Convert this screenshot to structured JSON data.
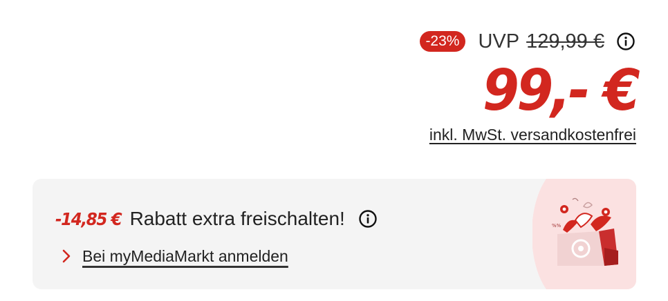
{
  "price": {
    "discount_badge": "-23%",
    "uvp_label": "UVP",
    "uvp_price": "129,99 €",
    "main_price": "99,- €",
    "tax_note": "inkl. MwSt. versandkostenfrei"
  },
  "promo": {
    "amount": "-14,85 €",
    "text": "Rabatt extra freischalten!",
    "login_link": "Bei myMediaMarkt anmelden"
  },
  "icons": {
    "info": "info-icon",
    "chevron": "chevron-right-icon",
    "illustration": "shopping-bag-gift-icon"
  },
  "colors": {
    "brand_red": "#d2271f",
    "card_background": "#f4f4f4",
    "illustration_background": "#fbe1e1"
  }
}
